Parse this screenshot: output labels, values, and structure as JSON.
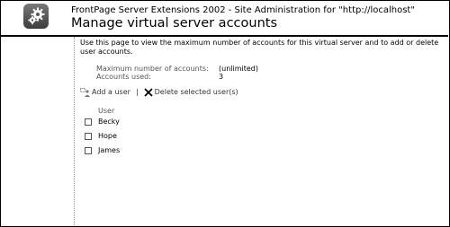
{
  "header": {
    "site_line": "FrontPage Server Extensions 2002 - Site Administration for \"http://localhost\"",
    "title": "Manage virtual server accounts",
    "logo_icon": "gears-icon"
  },
  "content": {
    "description": "Use this page to view the maximum number of accounts for this virtual server and to add or delete user accounts.",
    "stats": [
      {
        "label": "Maximum number of accounts:",
        "value": "(unlimited)"
      },
      {
        "label": "Accounts used:",
        "value": "3"
      }
    ],
    "toolbar": {
      "add_user": "Add a user",
      "separator": "|",
      "delete_selected": "Delete selected user(s)"
    },
    "users_header": "User",
    "users": [
      "Becky",
      "Hope",
      "James"
    ]
  },
  "colors": {
    "text": "#000000",
    "muted": "#555555"
  }
}
